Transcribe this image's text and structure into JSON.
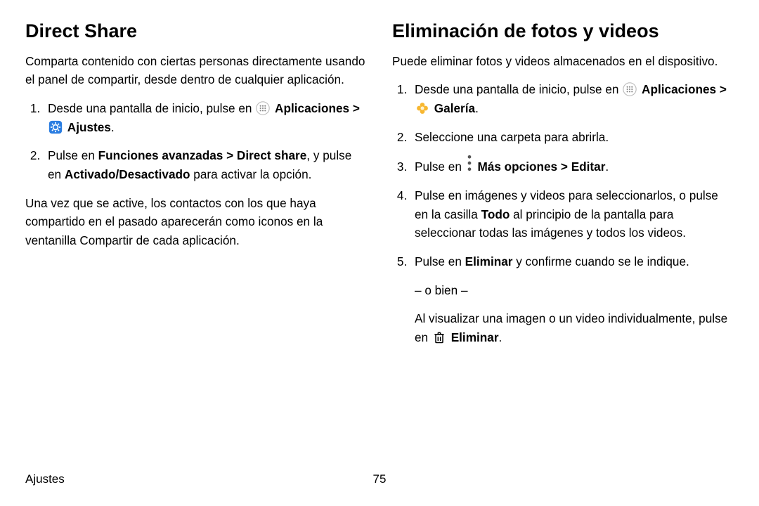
{
  "left": {
    "heading": "Direct Share",
    "intro": "Comparta contenido con ciertas personas directamente usando el panel de compartir, desde dentro de cualquier aplicación.",
    "step1_pre": "Desde una pantalla de inicio, pulse en ",
    "apps_label": "Aplicaciones",
    "sep": " > ",
    "ajustes_label": "Ajustes",
    "period": ".",
    "step2_pre": "Pulse en ",
    "step2_b1": "Funciones avanzadas > Direct share",
    "step2_mid": ", y pulse en ",
    "step2_b2": "Activado/Desactivado",
    "step2_post": " para activar la opción.",
    "outro": "Una vez que se active, los contactos con los que haya compartido en el pasado aparecerán como iconos en la ventanilla Compartir de cada aplicación."
  },
  "right": {
    "heading": "Eliminación de fotos y videos",
    "intro": "Puede eliminar fotos y videos almacenados en el dispositivo.",
    "step1_pre": "Desde una pantalla de inicio, pulse en ",
    "apps_label": "Aplicaciones",
    "sep": " > ",
    "galeria_label": "Galería",
    "period": ".",
    "step2": "Seleccione una carpeta para abrirla.",
    "step3_pre": "Pulse en ",
    "step3_b": "Más opciones > Editar",
    "step4_pre": "Pulse en imágenes y videos para seleccionarlos, o pulse en la casilla ",
    "step4_b": "Todo",
    "step4_post": " al principio de la pantalla para seleccionar todas las imágenes y todos los videos.",
    "step5_pre": "Pulse en ",
    "step5_b": "Eliminar",
    "step5_post": " y confirme cuando se le indique.",
    "or": "– o bien –",
    "alt_pre": "Al visualizar una imagen o un video individualmente, pulse en ",
    "alt_b": "Eliminar"
  },
  "footer": {
    "section": "Ajustes",
    "page": "75"
  }
}
